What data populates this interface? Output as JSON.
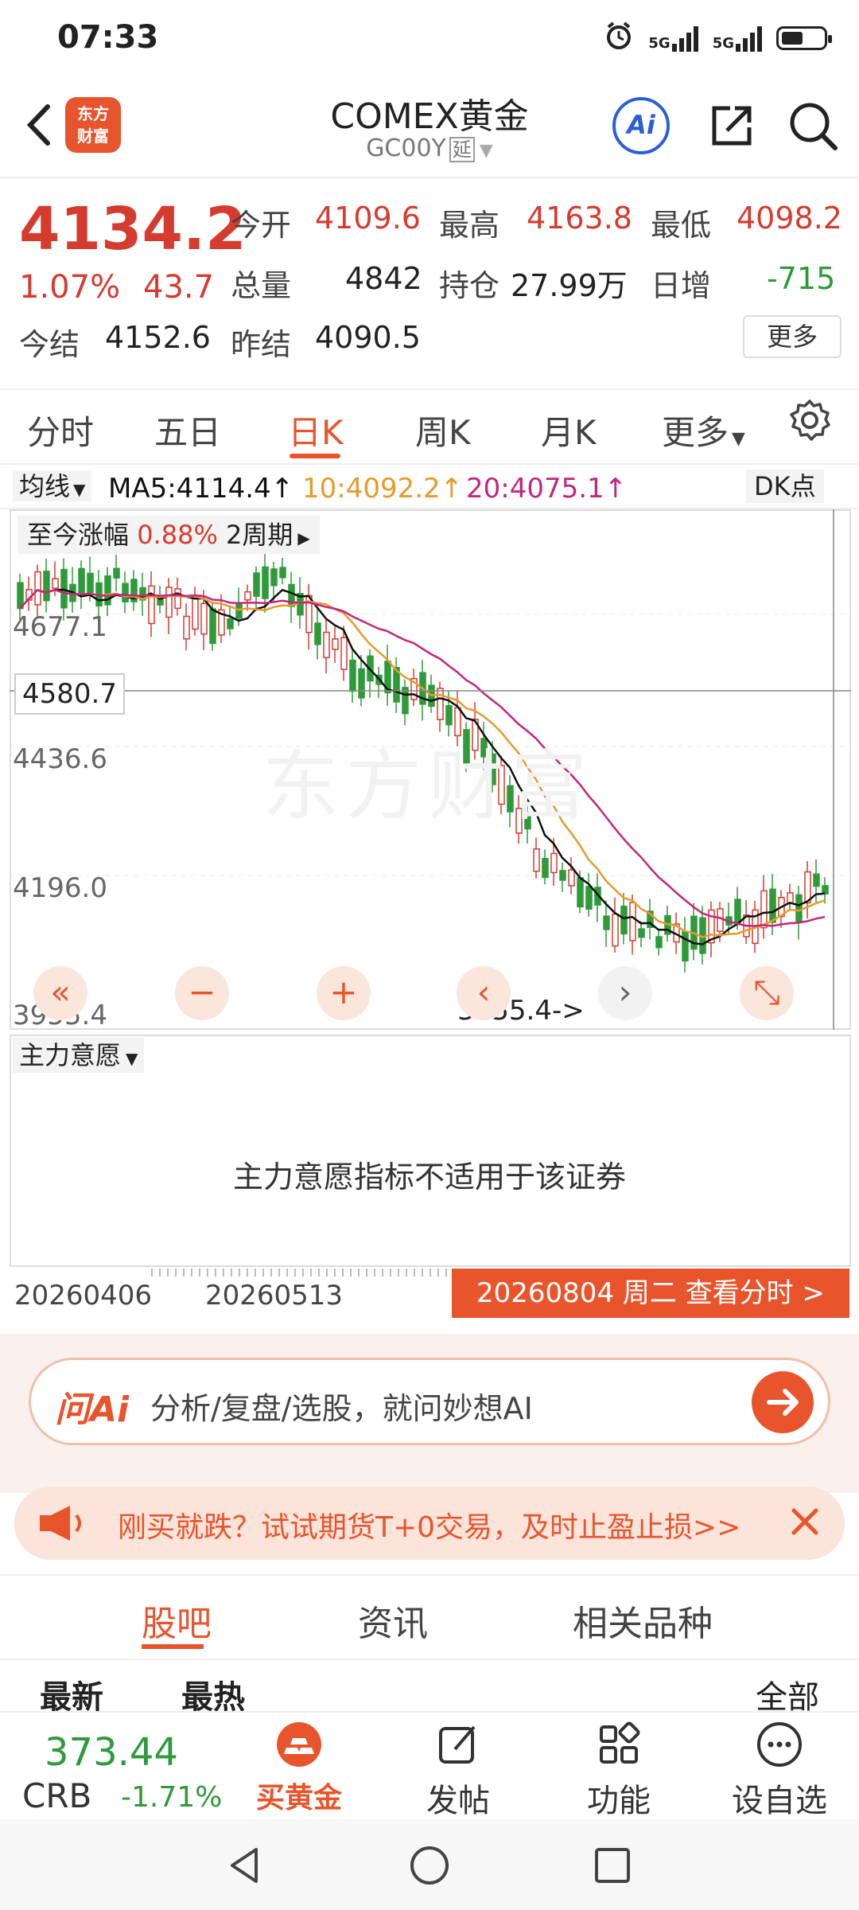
{
  "status_bar": {
    "time": "07:33",
    "net1": "5G",
    "net2": "5G"
  },
  "header": {
    "title": "COMEX黄金",
    "code": "GC00Y",
    "delay_badge": "延",
    "logo_line1": "东方",
    "logo_line2": "财富",
    "ai_label": "Ai"
  },
  "quote": {
    "price": "4134.2",
    "pct": "1.07%",
    "change": "43.7",
    "open_label": "今开",
    "open": "4109.6",
    "high_label": "最高",
    "high": "4163.8",
    "low_label": "最低",
    "low": "4098.2",
    "vol_label": "总量",
    "vol": "4842",
    "oi_label": "持仓",
    "oi": "27.99万",
    "inc_label": "日增",
    "inc": "-715",
    "settle_label": "今结",
    "settle": "4152.6",
    "prev_settle_label": "昨结",
    "prev_settle": "4090.5",
    "more": "更多"
  },
  "tabs": [
    "分时",
    "五日",
    "日K",
    "周K",
    "月K",
    "更多"
  ],
  "indicators": {
    "selector": "均线",
    "ma5": "MA5:4114.4↑",
    "ma10": "10:4092.2↑",
    "ma20": "20:4075.1↑",
    "dk": "DK点"
  },
  "chart": {
    "range_label": "至今涨幅",
    "range_pct": "0.88%",
    "range_period": "2周期",
    "y_labels": [
      "4677.1",
      "4436.6",
      "4196.0",
      "3955.4"
    ],
    "crosshair_price": "4580.7",
    "low_marker": "3955.4->",
    "watermark": "东方财富",
    "colors": {
      "up": "#d63b2f",
      "down": "#2e9a3a",
      "ma5": "#111111",
      "ma10": "#e89a2a",
      "ma20": "#c2267f"
    }
  },
  "chart_data": {
    "type": "candlestick",
    "ylim": [
      3955.4,
      4800
    ],
    "ma_lines": [
      "MA5",
      "MA10",
      "MA20"
    ]
  },
  "force": {
    "selector": "主力意愿",
    "message": "主力意愿指标不适用于该证券"
  },
  "dates": {
    "start": "20260406",
    "mid": "20260513",
    "badge": "20260804 周二 查看分时 >"
  },
  "ai_bar": {
    "logo": "问Ai",
    "text": "分析/复盘/选股，就问妙想AI"
  },
  "promo": {
    "text": "刚买就跌？试试期货T+0交易，及时止盈止损>>"
  },
  "sub_tabs": [
    "股吧",
    "资讯",
    "相关品种"
  ],
  "filters": {
    "latest": "最新",
    "hot": "最热",
    "all": "全部"
  },
  "bottom": {
    "crb_value": "373.44",
    "crb_name": "CRB",
    "crb_pct": "-1.71%",
    "buy": "买黄金",
    "post": "发帖",
    "func": "功能",
    "watch": "设自选"
  }
}
